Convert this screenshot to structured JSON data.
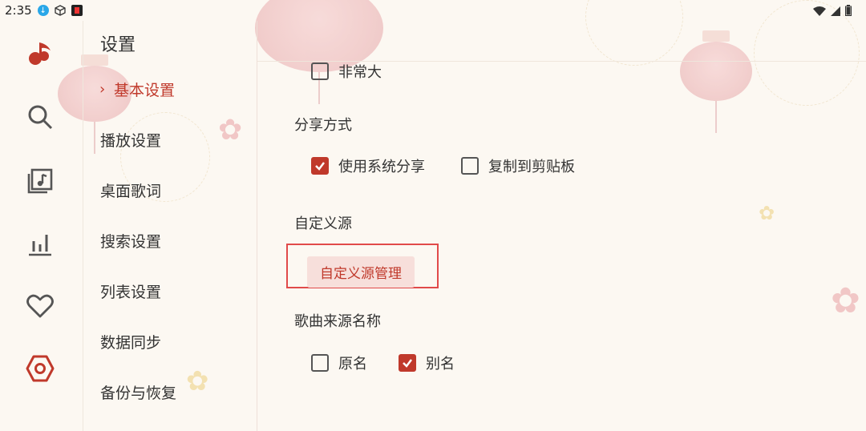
{
  "status": {
    "time": "2:35"
  },
  "nav": {
    "title": "设置",
    "items": [
      {
        "label": "基本设置",
        "active": true
      },
      {
        "label": "播放设置",
        "active": false
      },
      {
        "label": "桌面歌词",
        "active": false
      },
      {
        "label": "搜索设置",
        "active": false
      },
      {
        "label": "列表设置",
        "active": false
      },
      {
        "label": "数据同步",
        "active": false
      },
      {
        "label": "备份与恢复",
        "active": false
      }
    ]
  },
  "rail": {
    "icons": [
      "music-note-icon",
      "search-icon",
      "playlist-icon",
      "chart-icon",
      "heart-icon",
      "settings-icon"
    ]
  },
  "content": {
    "font_size_option": {
      "label": "非常大",
      "checked": false
    },
    "share": {
      "title": "分享方式",
      "options": [
        {
          "label": "使用系统分享",
          "checked": true
        },
        {
          "label": "复制到剪贴板",
          "checked": false
        }
      ]
    },
    "custom_source": {
      "title": "自定义源",
      "button_label": "自定义源管理"
    },
    "source_name": {
      "title": "歌曲来源名称",
      "options": [
        {
          "label": "原名",
          "checked": false
        },
        {
          "label": "别名",
          "checked": true
        }
      ]
    }
  },
  "colors": {
    "accent": "#c0392b",
    "highlight": "#e14a4a",
    "background": "#fcf8f2"
  }
}
